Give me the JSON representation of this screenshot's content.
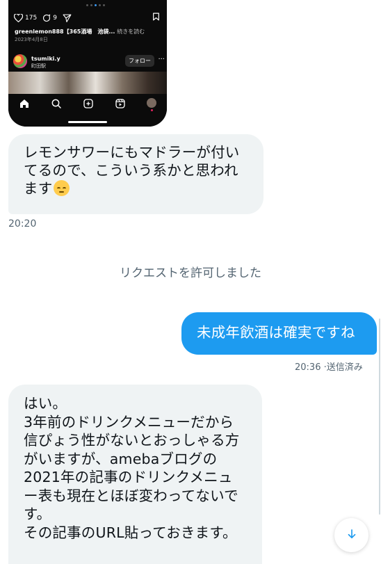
{
  "instagram_embed": {
    "likes": "175",
    "comments": "9",
    "caption_user": "greenlemon888",
    "caption_text": "【365酒場　池袋...",
    "caption_more": "続きを読む",
    "date": "2023年4月8日",
    "username": "tsumiki.y",
    "location": "町田駅",
    "follow_label": "フォロー",
    "menu_label": "···"
  },
  "messages": [
    {
      "direction": "in",
      "lines": [
        "レモンサワーにもマドラーが付い",
        "てるので、こういう系かと思われ",
        "ます"
      ],
      "emoji": "pensive-face",
      "time": "20:20"
    },
    {
      "direction": "out",
      "lines": [
        "未成年飲酒は確実ですね"
      ],
      "time": "20:36",
      "status": "送信済み"
    },
    {
      "direction": "in",
      "lines": [
        "はい。",
        "3年前のドリンクメニューだから",
        "信ぴょう性がないとおっしゃる方",
        "がいますが、amebaブログの",
        "2021年の記事のドリンクメニュ",
        "ー表も現在とほぼ変わってないで",
        "す。",
        "その記事のURL貼っておきます。"
      ]
    }
  ],
  "system_note": "リクエストを許可しました",
  "time_status_separator": " ·",
  "colors": {
    "outgoing_bubble": "#1d9bf0",
    "incoming_bubble": "#eff3f4",
    "meta_text": "#536471"
  },
  "icons": {
    "scroll_down": "arrow-down-icon"
  }
}
